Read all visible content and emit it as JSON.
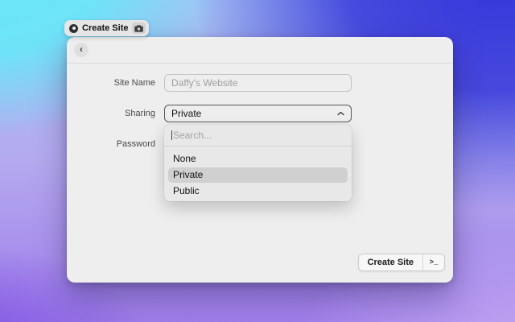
{
  "capture_tab": {
    "title": "Create Site"
  },
  "window": {
    "header": {
      "back_glyph": "‹"
    },
    "form": {
      "site_name_label": "Site Name",
      "site_name_placeholder": "Daffy's Website",
      "site_name_value": "",
      "sharing_label": "Sharing",
      "sharing_value": "Private",
      "password_label": "Password"
    },
    "dropdown": {
      "search_placeholder": "Search...",
      "options": [
        "None",
        "Private",
        "Public"
      ],
      "selected_option": "Private"
    },
    "footer": {
      "create_label": "Create Site",
      "shortcut_glyph": ">_"
    }
  },
  "colors": {
    "window_bg": "#eeeeee",
    "dropdown_bg": "#e8e8e8",
    "selected_option_bg": "#d0d0d0",
    "gradient_top_left": "#68e7f9",
    "gradient_top_right": "#3536da",
    "gradient_bottom_left": "#8156e3",
    "gradient_bottom_right": "#c7aff3"
  }
}
